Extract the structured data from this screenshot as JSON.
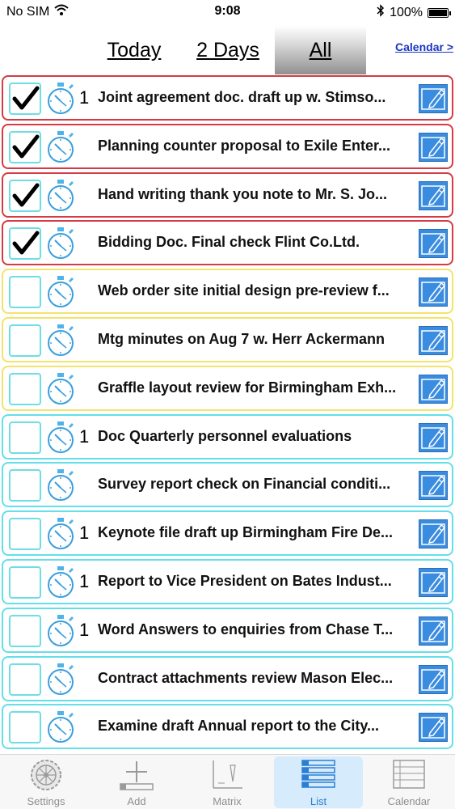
{
  "status_bar": {
    "carrier": "No SIM",
    "time": "9:08",
    "battery": "100%",
    "battery_level": 1.0
  },
  "tabs": {
    "today": "Today",
    "two_days": "2 Days",
    "all": "All",
    "active": "all"
  },
  "calendar_link": "Calendar >",
  "tasks": [
    {
      "title": "Joint agreement doc. draft up w. Stimso...",
      "checked": true,
      "timer_count": "1",
      "color": "red"
    },
    {
      "title": "Planning counter proposal to Exile Enter...",
      "checked": true,
      "timer_count": "",
      "color": "red"
    },
    {
      "title": "Hand writing thank you note to Mr. S. Jo...",
      "checked": true,
      "timer_count": "",
      "color": "red"
    },
    {
      "title": "Bidding Doc. Final check Flint Co.Ltd.",
      "checked": true,
      "timer_count": "",
      "color": "red"
    },
    {
      "title": "Web order site initial design pre-review f...",
      "checked": false,
      "timer_count": "",
      "color": "yellow"
    },
    {
      "title": "Mtg minutes on Aug 7 w. Herr Ackermann",
      "checked": false,
      "timer_count": "",
      "color": "yellow"
    },
    {
      "title": "Graffle layout review for Birmingham Exh...",
      "checked": false,
      "timer_count": "",
      "color": "yellow"
    },
    {
      "title": "Doc Quarterly personnel evaluations",
      "checked": false,
      "timer_count": "1",
      "color": "cyan"
    },
    {
      "title": "Survey report check on Financial conditi...",
      "checked": false,
      "timer_count": "",
      "color": "cyan"
    },
    {
      "title": "Keynote file draft up Birmingham Fire De...",
      "checked": false,
      "timer_count": "1",
      "color": "cyan"
    },
    {
      "title": "Report to Vice President on Bates Indust...",
      "checked": false,
      "timer_count": "1",
      "color": "cyan"
    },
    {
      "title": "Word Answers to enquiries from Chase T...",
      "checked": false,
      "timer_count": "1",
      "color": "cyan"
    },
    {
      "title": "Contract attachments review Mason Elec...",
      "checked": false,
      "timer_count": "",
      "color": "cyan"
    },
    {
      "title": "Examine draft  Annual report to the City...",
      "checked": false,
      "timer_count": "",
      "color": "cyan"
    }
  ],
  "colors": {
    "red": "#d63a44",
    "yellow": "#f1e46d",
    "cyan": "#63dfe9",
    "accent": "#2a7fd4",
    "link": "#1a35c2"
  },
  "tab_bar": [
    {
      "label": "Settings",
      "icon": "gear-icon",
      "active": false
    },
    {
      "label": "Add",
      "icon": "plus-icon",
      "active": false
    },
    {
      "label": "Matrix",
      "icon": "matrix-icon",
      "active": false
    },
    {
      "label": "List",
      "icon": "list-icon",
      "active": true
    },
    {
      "label": "Calendar",
      "icon": "calendar-icon",
      "active": false
    }
  ]
}
